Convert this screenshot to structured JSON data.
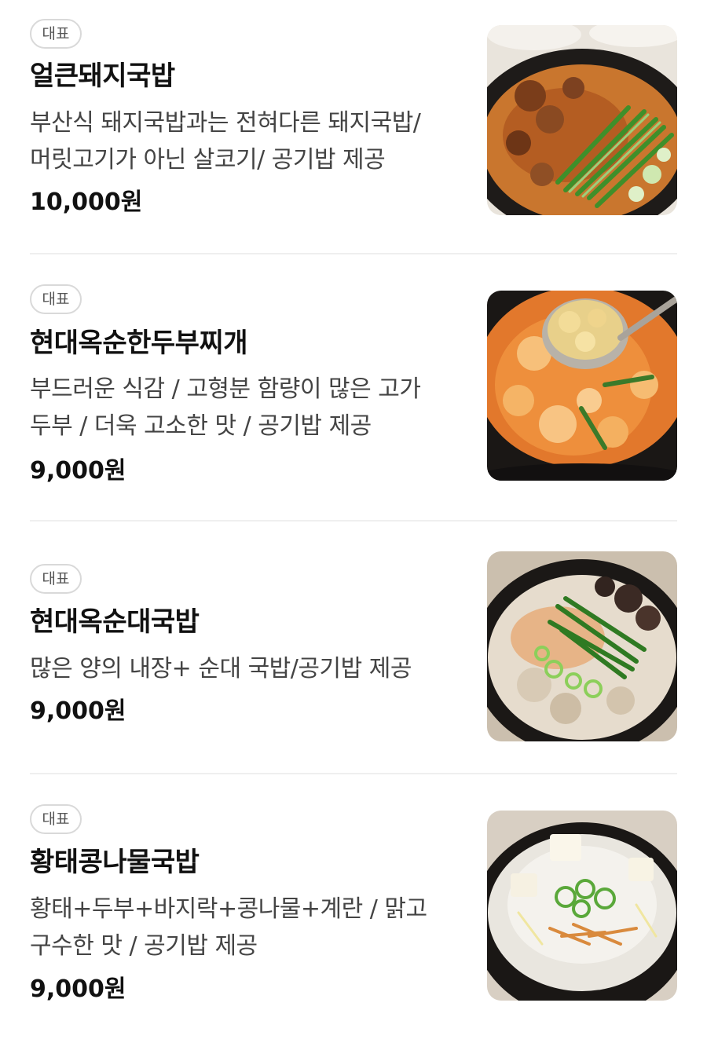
{
  "menu": {
    "items": [
      {
        "badge": "대표",
        "name": "얼큰돼지국밥",
        "desc_lines": [
          "부산식 돼지국밥과는 전혀다른 돼지국밥/",
          "머릿고기가 아닌 살코기/ 공기밥 제공"
        ],
        "price": "10,000원",
        "image_alt": "spicy pork gukbap photo"
      },
      {
        "badge": "대표",
        "name": "현대옥순한두부찌개",
        "desc_lines": [
          "부드러운 식감 / 고형분 함량이 많은 고가",
          "두부 / 더욱 고소한 맛 / 공기밥 제공"
        ],
        "price": "9,000원",
        "image_alt": "mild tofu stew photo"
      },
      {
        "badge": "대표",
        "name": "현대옥순대국밥",
        "desc_lines": [
          "많은 양의 내장+ 순대 국밥/공기밥 제공"
        ],
        "price": "9,000원",
        "image_alt": "sundae gukbap photo"
      },
      {
        "badge": "대표",
        "name": "황태콩나물국밥",
        "desc_lines": [
          "황태+두부+바지락+콩나물+계란 / 맑고",
          "구수한 맛 / 공기밥 제공"
        ],
        "price": "9,000원",
        "image_alt": "dried pollock bean sprout gukbap photo"
      }
    ]
  },
  "colors": {
    "badge_border": "#d9d9d9",
    "badge_text": "#555555",
    "desc_text": "#444444",
    "divider": "#efefef"
  }
}
